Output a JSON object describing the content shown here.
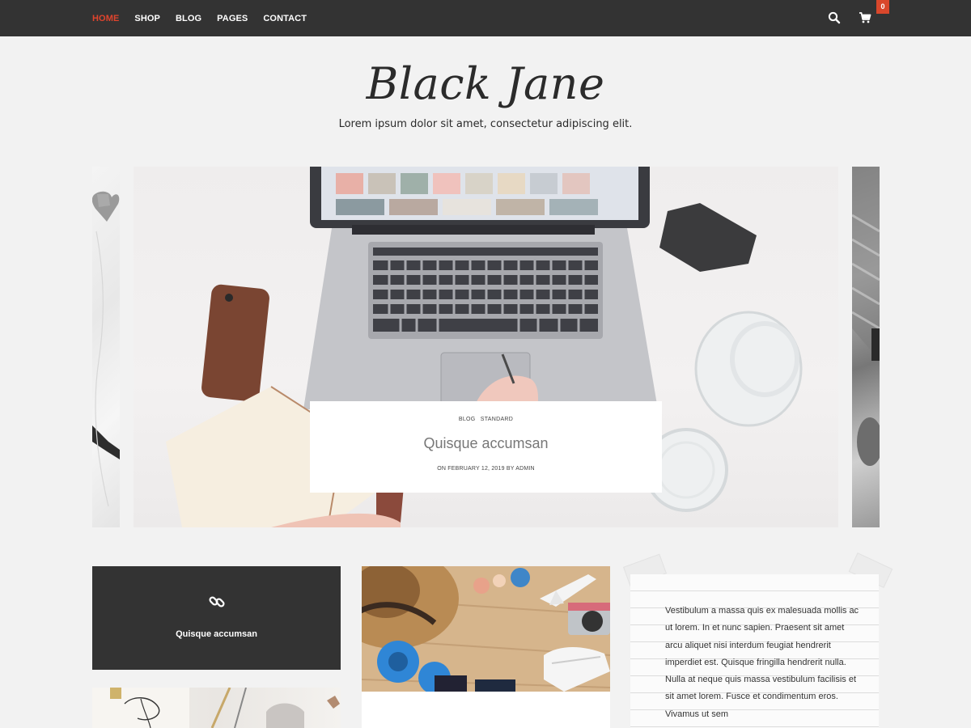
{
  "nav": {
    "items": [
      {
        "label": "HOME",
        "active": true
      },
      {
        "label": "SHOP"
      },
      {
        "label": "BLOG"
      },
      {
        "label": "PAGES"
      },
      {
        "label": "CONTACT"
      }
    ],
    "search_icon": "search-icon",
    "cart_icon": "cart-icon",
    "cart_count": "0",
    "accent_color": "#e0442d"
  },
  "header": {
    "title": "Black Jane",
    "tagline": "Lorem ipsum dolor sit amet, consectetur adipiscing elit."
  },
  "slider": {
    "categories": [
      "BLOG",
      "STANDARD"
    ],
    "title": "Quisque accumsan",
    "meta": "ON FEBRUARY 12, 2019 BY ADMIN"
  },
  "posts": {
    "link_post_title": "Quisque accumsan",
    "link_icon": "link-icon",
    "quote_text": "Vestibulum a massa quis ex malesuada mollis ac ut lorem. In et nunc sapien. Praesent sit amet arcu aliquet nisi interdum feugiat hendrerit imperdiet est. Quisque fringilla hendrerit nulla. Nulla at neque quis massa vestibulum facilisis et sit amet lorem. Fusce et condimentum eros. Vivamus ut sem"
  }
}
